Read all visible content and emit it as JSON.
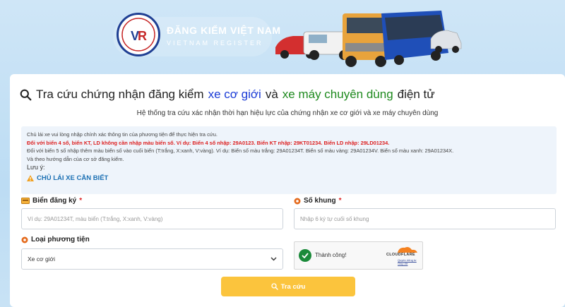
{
  "header": {
    "logo_title": "ĐĂNG KIỂM VIỆT NAM",
    "logo_subtitle": "VIETNAM REGISTER",
    "seal_text": "ĐĂNG KIỂM VIỆT NAM · VIETNAM REGISTER"
  },
  "headline": {
    "part1": "Tra cứu chứng nhận đăng kiểm",
    "part2": "xe cơ giới",
    "part3": "và",
    "part4": "xe máy chuyên dùng",
    "part5": "điện tử"
  },
  "subtitle": "Hệ thống tra cứu xác nhận thời hạn hiệu lực của chứng nhận xe cơ giới và xe máy chuyên dùng",
  "notice": {
    "line1": "Chủ lái xe vui lòng nhập chính xác thông tin của phương tiện để thực hiện tra cứu.",
    "line2": "Đối với biển 4 số, biển KT, LD không cần nhập màu biển số. Ví dụ: Biển 4 số nhập: 29A0123. Biển KT nhập: 29KT01234. Biển LD nhập: 29LD01234.",
    "line3": "Đối với biển 5 số nhập thêm màu biển số vào cuối biển (T:trắng, X:xanh, V:vàng). Ví dụ: Biển số màu trắng: 29A01234T. Biển số màu vàng: 29A01234V. Biển số màu xanh: 29A01234X.",
    "line4": "Và theo hướng dẫn của cơ sở đăng kiểm.",
    "note_label": "Lưu ý:",
    "warning_link": "CHỦ LÁI XE CẦN BIẾT"
  },
  "form": {
    "plate_label": "Biển đăng ký",
    "plate_placeholder": "Ví dụ: 29A01234T, màu biển (T:trắng, X:xanh, V:vàng)",
    "frame_label": "Số khung",
    "frame_placeholder": "Nhập 6 ký tự cuối số khung",
    "required_mark": "*",
    "vehicle_type_label": "Loại phương tiện",
    "vehicle_type_value": "Xe cơ giới",
    "captcha_status": "Thành công!",
    "captcha_brand": "CLOUDFLARE",
    "captcha_link1": "Quyền riêng tư",
    "captcha_link2": "Giúp đỡ",
    "submit_label": "Tra cứu"
  },
  "colors": {
    "accent_blue": "#1a3bd6",
    "accent_green": "#1f8a1f",
    "submit": "#fbc43d",
    "required": "#d22222"
  }
}
